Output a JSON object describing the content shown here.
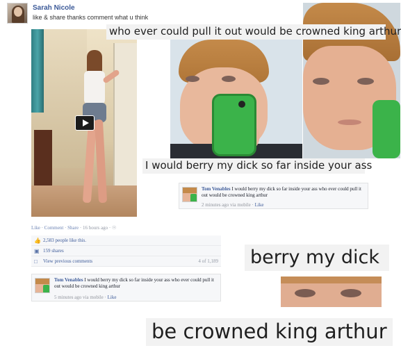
{
  "post": {
    "author": "Sarah Nicole",
    "text": "like & share thanks comment what u think",
    "actions": {
      "like": "Like",
      "comment": "Comment",
      "share": "Share",
      "time": "16 hours ago",
      "sep": "·"
    },
    "likes": "2,583 people like this.",
    "shares": "159 shares",
    "view_previous": "View previous comments",
    "comment_count": "4 of 1,189"
  },
  "comments": [
    {
      "name": "Tom Venables",
      "text": "I would berry my dick so far inside your ass who ever could pull it out would be crowned king arthur",
      "meta": "2 minutes ago via mobile",
      "like": "Like"
    },
    {
      "name": "Tom Venables",
      "text": "I would berry my dick so far inside your ass who ever could pull it out would be crowned king arthur",
      "meta": "5 minutes ago via mobile",
      "like": "Like"
    }
  ],
  "meme": {
    "caption_top": "who ever could pull it out would be crowned king arthur",
    "caption_mid": "I would berry my dick so far inside your ass",
    "caption_berry": "berry my dick",
    "caption_bottom": "be crowned king arthur"
  },
  "icons": {
    "play": "play-icon",
    "like": "thumbs-up-icon",
    "share": "share-icon",
    "comment": "comment-icon",
    "globe": "globe-icon"
  },
  "colors": {
    "link": "#3b5998",
    "muted": "#9197a3",
    "card_bg": "#f6f7f9",
    "phone_green": "#3bb34a"
  }
}
